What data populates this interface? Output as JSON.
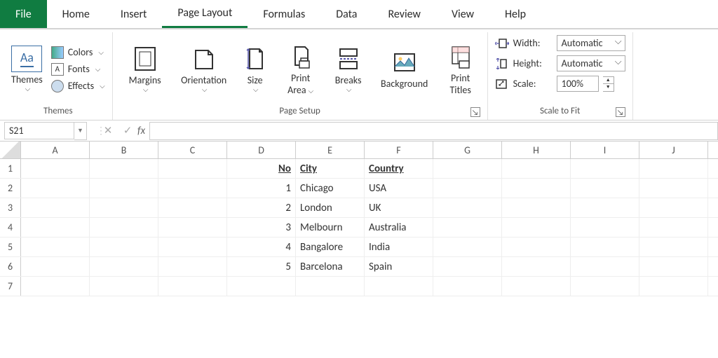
{
  "tabs": {
    "file": "File",
    "items": [
      "Home",
      "Insert",
      "Page Layout",
      "Formulas",
      "Data",
      "Review",
      "View",
      "Help"
    ],
    "active_index": 2
  },
  "ribbon": {
    "themes": {
      "main_label": "Themes",
      "colors": "Colors",
      "fonts": "Fonts",
      "effects": "Effects",
      "group_label": "Themes"
    },
    "page_setup": {
      "margins": "Margins",
      "orientation": "Orientation",
      "size": "Size",
      "print_area": "Print Area",
      "breaks": "Breaks",
      "background": "Background",
      "print_titles": "Print Titles",
      "group_label": "Page Setup"
    },
    "scale": {
      "width_label": "Width:",
      "width_value": "Automatic",
      "height_label": "Height:",
      "height_value": "Automatic",
      "scale_label": "Scale:",
      "scale_value": "100%",
      "group_label": "Scale to Fit"
    }
  },
  "formula_bar": {
    "name_box": "S21",
    "fx": "fx",
    "value": ""
  },
  "grid": {
    "columns": [
      "A",
      "B",
      "C",
      "D",
      "E",
      "F",
      "G",
      "H",
      "I",
      "J"
    ],
    "rows": [
      {
        "n": "1",
        "cells": {
          "D": {
            "v": "No",
            "hdr": true,
            "num": true
          },
          "E": {
            "v": "City",
            "hdr": true
          },
          "F": {
            "v": "Country",
            "hdr": true
          }
        }
      },
      {
        "n": "2",
        "cells": {
          "D": {
            "v": "1",
            "num": true
          },
          "E": {
            "v": "Chicago"
          },
          "F": {
            "v": "USA"
          }
        }
      },
      {
        "n": "3",
        "cells": {
          "D": {
            "v": "2",
            "num": true
          },
          "E": {
            "v": "London"
          },
          "F": {
            "v": "UK"
          }
        }
      },
      {
        "n": "4",
        "cells": {
          "D": {
            "v": "3",
            "num": true
          },
          "E": {
            "v": "Melbourn",
            "overflow": true
          },
          "F": {
            "v": "Australia"
          }
        }
      },
      {
        "n": "5",
        "cells": {
          "D": {
            "v": "4",
            "num": true
          },
          "E": {
            "v": "Bangalore",
            "overflow": true
          },
          "F": {
            "v": "India"
          }
        }
      },
      {
        "n": "6",
        "cells": {
          "D": {
            "v": "5",
            "num": true
          },
          "E": {
            "v": "Barcelona",
            "overflow": true
          },
          "F": {
            "v": "Spain"
          }
        }
      },
      {
        "n": "7",
        "cells": {}
      }
    ]
  }
}
